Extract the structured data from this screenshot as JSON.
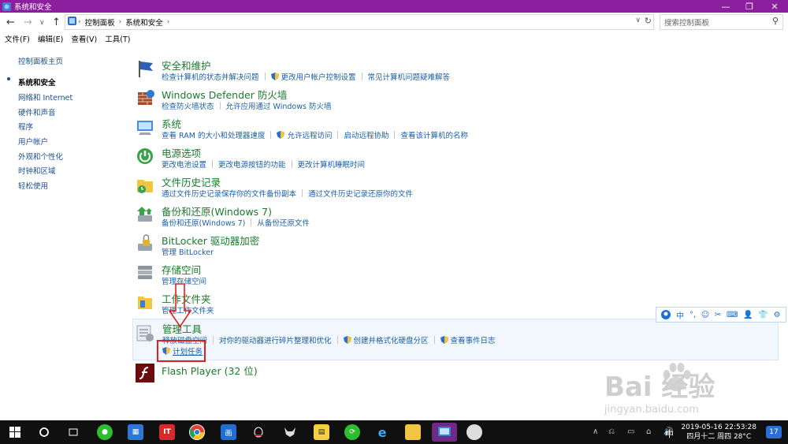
{
  "window": {
    "title": "系统和安全"
  },
  "address": {
    "crumbs": [
      "控制面板",
      "系统和安全"
    ],
    "search_placeholder": "搜索控制面板"
  },
  "menu": [
    "文件(F)",
    "编辑(E)",
    "查看(V)",
    "工具(T)"
  ],
  "sidebar": {
    "home": "控制面板主页",
    "items": [
      "系统和安全",
      "网络和 Internet",
      "硬件和声音",
      "程序",
      "用户帐户",
      "外观和个性化",
      "时钟和区域",
      "轻松使用"
    ]
  },
  "categories": [
    {
      "title": "安全和维护",
      "links": [
        "检查计算机的状态并解决问题",
        "更改用户帐户控制设置",
        "常见计算机问题疑难解答"
      ]
    },
    {
      "title": "Windows Defender 防火墙",
      "links": [
        "检查防火墙状态",
        "允许应用通过 Windows 防火墙"
      ]
    },
    {
      "title": "系统",
      "links": [
        "查看 RAM 的大小和处理器速度",
        "允许远程访问",
        "启动远程协助",
        "查看该计算机的名称"
      ]
    },
    {
      "title": "电源选项",
      "links": [
        "更改电池设置",
        "更改电源按钮的功能",
        "更改计算机睡眠时间"
      ]
    },
    {
      "title": "文件历史记录",
      "links": [
        "通过文件历史记录保存你的文件备份副本",
        "通过文件历史记录还原你的文件"
      ]
    },
    {
      "title": "备份和还原(Windows 7)",
      "links": [
        "备份和还原(Windows 7)",
        "从备份还原文件"
      ]
    },
    {
      "title": "BitLocker 驱动器加密",
      "links": [
        "管理 BitLocker"
      ]
    },
    {
      "title": "存储空间",
      "links": [
        "管理存储空间"
      ]
    },
    {
      "title": "工作文件夹",
      "links": [
        "管理工作文件夹"
      ]
    },
    {
      "title": "管理工具",
      "links": [
        "释放磁盘空间",
        "对你的驱动器进行碎片整理和优化",
        "创建并格式化硬盘分区",
        "查看事件日志"
      ],
      "links2": [
        "计划任务"
      ]
    },
    {
      "title": "Flash Player (32 位)",
      "links": []
    }
  ],
  "ime_toolbar": [
    "中",
    "°,",
    "☺",
    "⌨",
    "👕",
    "⚙"
  ],
  "watermark": {
    "logo": "Bai  经验",
    "url": "jingyan.baidu.com"
  },
  "taskbar": {
    "ime": "中",
    "time": "2019-05-16  22:53:28",
    "date": "四月十二 周四 28°C",
    "notifications": "17"
  },
  "colors": {
    "titlebar": "#8b1f9e",
    "link": "#1b5fa8",
    "category": "#1b7a2d",
    "annotation": "#e02020"
  }
}
